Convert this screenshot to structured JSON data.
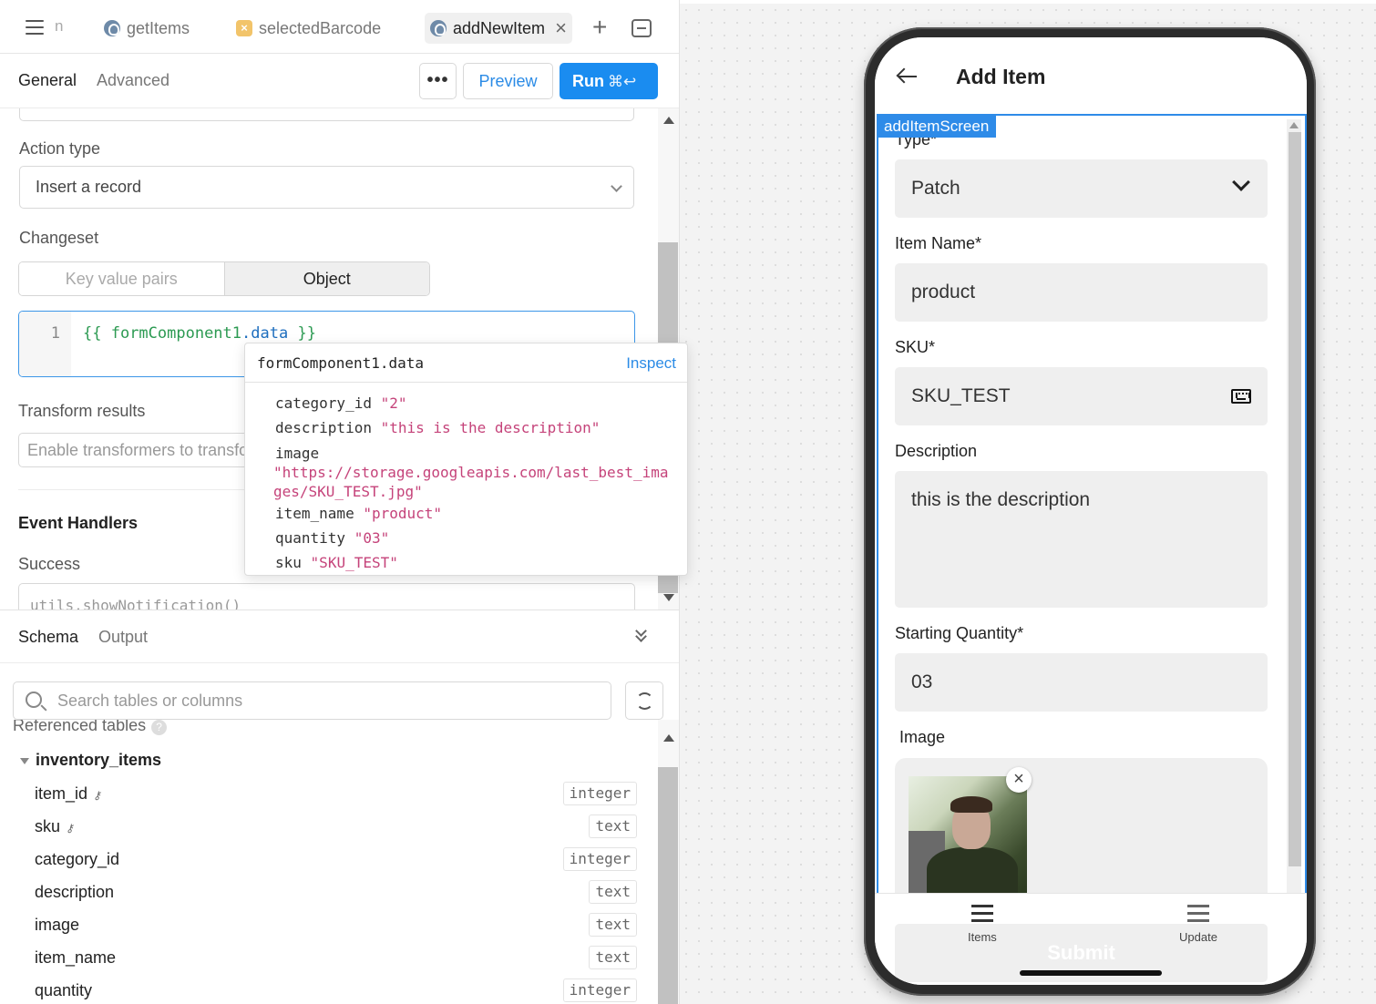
{
  "tabs": {
    "clipped": "n",
    "items": [
      {
        "label": "getItems"
      },
      {
        "label": "selectedBarcode"
      },
      {
        "label": "addNewItem"
      }
    ]
  },
  "query": {
    "subtabs": {
      "general": "General",
      "advanced": "Advanced"
    },
    "more_label": "•••",
    "preview_label": "Preview",
    "run_label": "Run",
    "run_shortcut": "⌘↩",
    "action_type_label": "Action type",
    "action_type_value": "Insert a record",
    "changeset_label": "Changeset",
    "changeset_options": [
      "Key value pairs",
      "Object"
    ],
    "code_line_number": "1",
    "code_open": "{{ ",
    "code_obj": "formComponent1",
    "code_dot": ".",
    "code_prop": "data",
    "code_close": " }}",
    "transform_label": "Transform results",
    "transform_placeholder": "Enable transformers to transform results",
    "event_handlers_label": "Event Handlers",
    "success_label": "Success",
    "success_value": "utils.showNotification()"
  },
  "popup": {
    "title": "formComponent1.data",
    "inspect": "Inspect",
    "fields": [
      {
        "key": "category_id",
        "value": "\"2\""
      },
      {
        "key": "description",
        "value": "\"this is the description\""
      },
      {
        "key": "image",
        "value": "\"https://storage.googleapis.com/last_best_images/SKU_TEST.jpg\""
      },
      {
        "key": "item_name",
        "value": "\"product\""
      },
      {
        "key": "quantity",
        "value": "\"03\""
      },
      {
        "key": "sku",
        "value": "\"SKU_TEST\""
      }
    ]
  },
  "schema": {
    "tabs": {
      "schema": "Schema",
      "output": "Output"
    },
    "search_placeholder": "Search tables or columns",
    "referenced_label": "Referenced tables",
    "help_mark": "?",
    "table_name": "inventory_items",
    "columns": [
      {
        "name": "item_id",
        "type": "integer",
        "key": "⚷"
      },
      {
        "name": "sku",
        "type": "text",
        "key": "⚷"
      },
      {
        "name": "category_id",
        "type": "integer",
        "key": ""
      },
      {
        "name": "description",
        "type": "text",
        "key": ""
      },
      {
        "name": "image",
        "type": "text",
        "key": ""
      },
      {
        "name": "item_name",
        "type": "text",
        "key": ""
      },
      {
        "name": "quantity",
        "type": "integer",
        "key": ""
      }
    ]
  },
  "phone": {
    "title": "Add Item",
    "selection_badge": "addItemScreen",
    "form": {
      "type_label": "Type*",
      "type_value": "Patch",
      "item_name_label": "Item Name*",
      "item_name_value": "product",
      "sku_label": "SKU*",
      "sku_value": "SKU_TEST",
      "description_label": "Description",
      "description_value": "this is the description",
      "quantity_label": "Starting Quantity*",
      "quantity_value": "03",
      "image_label": "Image",
      "remove_mark": "×"
    },
    "submit_label": "Submit",
    "nav": [
      {
        "label": "Items"
      },
      {
        "label": "Update"
      }
    ]
  },
  "colors": {
    "accent": "#1a8cf0",
    "selection": "#2e8be8",
    "string_value": "#c5437a",
    "code_green": "#2c9a52"
  }
}
